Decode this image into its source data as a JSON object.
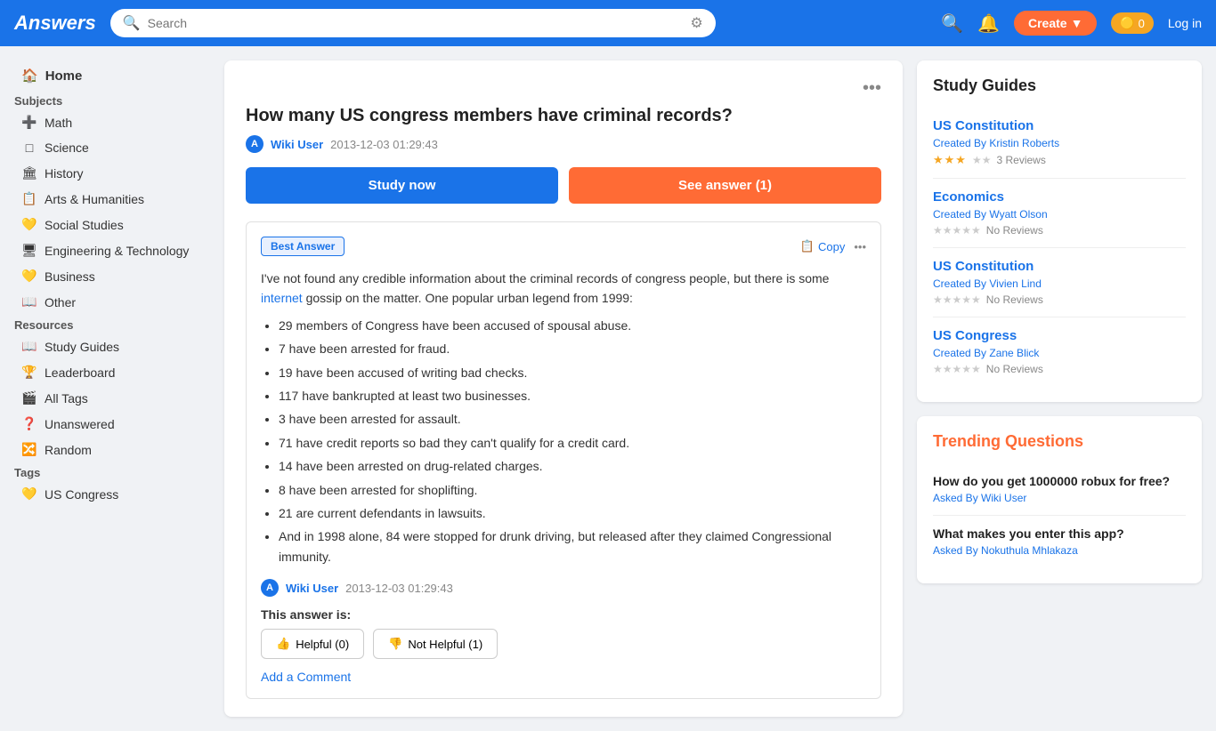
{
  "header": {
    "logo": "Answers",
    "search_placeholder": "Search",
    "create_label": "Create",
    "create_arrow": "▼",
    "coins": "0",
    "login_label": "Log in"
  },
  "sidebar": {
    "home_label": "Home",
    "subjects_label": "Subjects",
    "items": [
      {
        "id": "math",
        "icon": "➕",
        "label": "Math"
      },
      {
        "id": "science",
        "icon": "□",
        "label": "Science"
      },
      {
        "id": "history",
        "icon": "🏛",
        "label": "History"
      },
      {
        "id": "arts-humanities",
        "icon": "📋",
        "label": "Arts & Humanities"
      },
      {
        "id": "social-studies",
        "icon": "💛",
        "label": "Social Studies"
      },
      {
        "id": "engineering-technology",
        "icon": "🖥",
        "label": "Engineering & Technology"
      },
      {
        "id": "business",
        "icon": "💛",
        "label": "Business"
      },
      {
        "id": "other",
        "icon": "📖",
        "label": "Other"
      }
    ],
    "resources_label": "Resources",
    "resources": [
      {
        "id": "study-guides",
        "icon": "📖",
        "label": "Study Guides"
      },
      {
        "id": "leaderboard",
        "icon": "🏆",
        "label": "Leaderboard"
      },
      {
        "id": "all-tags",
        "icon": "🎬",
        "label": "All Tags"
      },
      {
        "id": "unanswered",
        "icon": "❓",
        "label": "Unanswered"
      },
      {
        "id": "random",
        "icon": "🔀",
        "label": "Random"
      }
    ],
    "tags_label": "Tags",
    "tags": [
      {
        "id": "us-congress",
        "icon": "💛",
        "label": "US Congress"
      }
    ]
  },
  "question": {
    "title": "How many US congress members have criminal records?",
    "author": "Wiki User",
    "timestamp": "2013-12-03 01:29:43",
    "study_now_label": "Study now",
    "see_answer_label": "See answer (1)"
  },
  "answer": {
    "best_answer_label": "Best Answer",
    "copy_label": "Copy",
    "body_intro": "I've not found any credible information about the criminal records of congress people, but there is some",
    "link_text": "internet",
    "body_after": "gossip on the matter. One popular urban legend from 1999:",
    "bullet_points": [
      "29 members of Congress have been accused of spousal abuse.",
      "7 have been arrested for fraud.",
      "19 have been accused of writing bad checks.",
      "117 have bankrupted at least two businesses.",
      "3 have been arrested for assault.",
      "71 have credit reports so bad they can't qualify for a credit card.",
      "14 have been arrested on drug-related charges.",
      "8 have been arrested for shoplifting.",
      "21 are current defendants in lawsuits.",
      "And in 1998 alone, 84 were stopped for drunk driving, but released after they claimed Congressional immunity."
    ],
    "answer_author": "Wiki User",
    "answer_timestamp": "2013-12-03 01:29:43",
    "this_answer_is_label": "This answer is:",
    "helpful_label": "Helpful (0)",
    "not_helpful_label": "Not Helpful (1)",
    "add_comment_label": "Add a Comment"
  },
  "study_guides": {
    "section_title": "Study Guides",
    "guides": [
      {
        "name": "US Constitution",
        "created_by_label": "Created By",
        "author": "Kristin Roberts",
        "rating": 3.0,
        "review_count": "3 Reviews"
      },
      {
        "name": "Economics",
        "created_by_label": "Created By",
        "author": "Wyatt Olson",
        "rating": 0,
        "review_count": "No Reviews"
      },
      {
        "name": "US Constitution",
        "created_by_label": "Created By",
        "author": "Vivien Lind",
        "rating": 0,
        "review_count": "No Reviews"
      },
      {
        "name": "US Congress",
        "created_by_label": "Created By",
        "author": "Zane Blick",
        "rating": 0,
        "review_count": "No Reviews"
      }
    ]
  },
  "trending": {
    "section_title": "Trending Questions",
    "questions": [
      {
        "text": "How do you get 1000000 robux for free?",
        "asked_by_label": "Asked By",
        "author": "Wiki User"
      },
      {
        "text": "What makes you enter this app?",
        "asked_by_label": "Asked By",
        "author": "Nokuthula Mhlakaza"
      }
    ]
  }
}
